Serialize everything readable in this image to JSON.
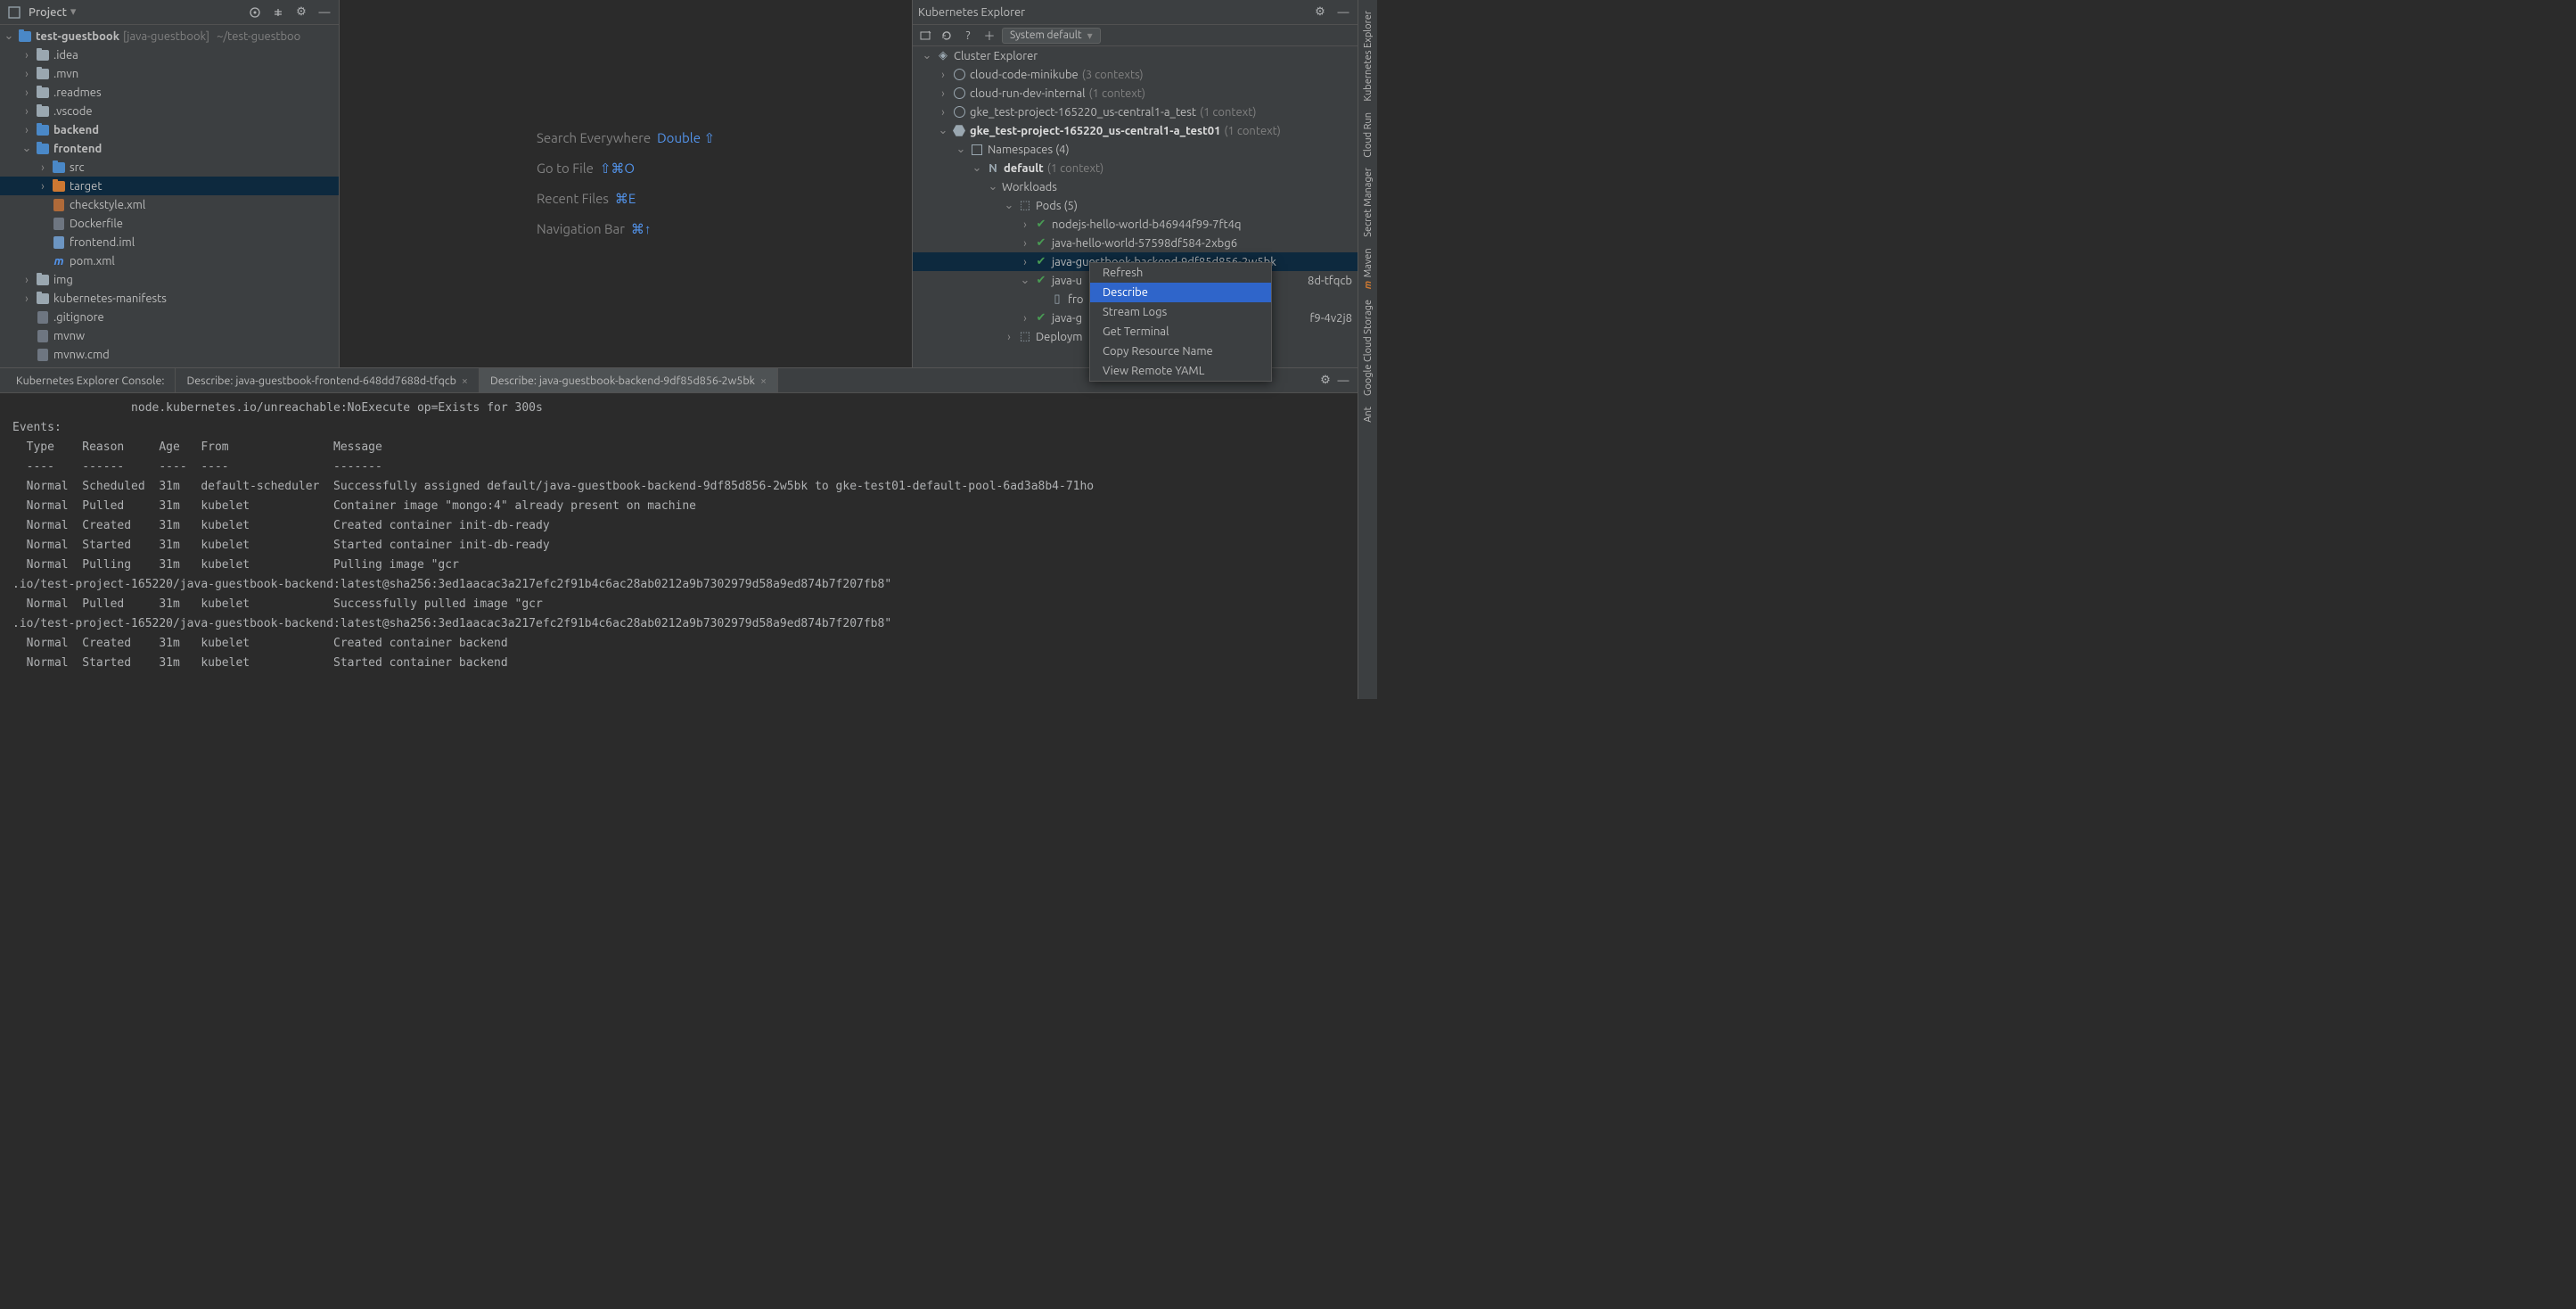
{
  "project_panel": {
    "title": "Project",
    "root": {
      "name": "test-guestbook",
      "bracket": "[java-guestbook]",
      "path": "~/test-guestboo"
    },
    "items": [
      {
        "indent": 1,
        "name": ".idea",
        "folder": "gray",
        "chev": "›"
      },
      {
        "indent": 1,
        "name": ".mvn",
        "folder": "gray",
        "chev": "›"
      },
      {
        "indent": 1,
        "name": ".readmes",
        "folder": "gray",
        "chev": "›"
      },
      {
        "indent": 1,
        "name": ".vscode",
        "folder": "gray",
        "chev": "›"
      },
      {
        "indent": 1,
        "name": "backend",
        "folder": "blue",
        "chev": "›",
        "bold": true
      },
      {
        "indent": 1,
        "name": "frontend",
        "folder": "blue",
        "chev": "⌄",
        "bold": true
      },
      {
        "indent": 2,
        "name": "src",
        "folder": "blue",
        "chev": "›"
      },
      {
        "indent": 2,
        "name": "target",
        "folder": "or",
        "chev": "›",
        "sel": true
      },
      {
        "indent": 2,
        "name": "checkstyle.xml",
        "file": "xml"
      },
      {
        "indent": 2,
        "name": "Dockerfile",
        "file": "plain"
      },
      {
        "indent": 2,
        "name": "frontend.iml",
        "file": "iml"
      },
      {
        "indent": 2,
        "name": "pom.xml",
        "file": "m"
      },
      {
        "indent": 1,
        "name": "img",
        "folder": "gray",
        "chev": "›"
      },
      {
        "indent": 1,
        "name": "kubernetes-manifests",
        "folder": "gray",
        "chev": "›"
      },
      {
        "indent": 1,
        "name": ".gitignore",
        "file": "plain"
      },
      {
        "indent": 1,
        "name": "mvnw",
        "file": "plain"
      },
      {
        "indent": 1,
        "name": "mvnw.cmd",
        "file": "plain"
      }
    ]
  },
  "hints": {
    "search": {
      "label": "Search Everywhere",
      "key": "Double ⇧"
    },
    "goto": {
      "label": "Go to File",
      "key": "⇧⌘O"
    },
    "recent": {
      "label": "Recent Files",
      "key": "⌘E"
    },
    "nav": {
      "label": "Navigation Bar",
      "key": "⌘↑"
    }
  },
  "kube": {
    "title": "Kubernetes Explorer",
    "combo": "System default",
    "root": "Cluster Explorer",
    "clusters": [
      {
        "name": "cloud-code-minikube",
        "ctx": "(3 contexts)",
        "ico": "circ",
        "chev": "›"
      },
      {
        "name": "cloud-run-dev-internal",
        "ctx": "(1 context)",
        "ico": "circ",
        "chev": "›"
      },
      {
        "name": "gke_test-project-165220_us-central1-a_test",
        "ctx": "(1 context)",
        "ico": "circ",
        "chev": "›"
      },
      {
        "name": "gke_test-project-165220_us-central1-a_test01",
        "ctx": "(1 context)",
        "ico": "hex",
        "chev": "⌄",
        "bold": true
      }
    ],
    "ns_label": "Namespaces (4)",
    "default_ns": {
      "name": "default",
      "ctx": "(1 context)"
    },
    "workloads": "Workloads",
    "pods_label": "Pods (5)",
    "pods": [
      {
        "name": "nodejs-hello-world-b46944f99-7ft4q",
        "chev": "›"
      },
      {
        "name": "java-hello-world-57598df584-2xbg6",
        "chev": "›"
      },
      {
        "name": "java-guestbook-backend-9df85d856-2w5bk",
        "chev": "›",
        "sel": true
      },
      {
        "name": "java-guestbook-frontend-648dd7688d-tfqcb",
        "vis": "java-u",
        "tail": "8d-tfqcb",
        "chev": "⌄"
      },
      {
        "name_child": "frontend",
        "vis": "fro"
      },
      {
        "name": "java-guestbook-mongodb-6cf944c5f9-4v2j8",
        "vis": "java-g",
        "tail": "f9-4v2j8",
        "chev": "›"
      }
    ],
    "deploy_label": "Deploym",
    "context_menu": [
      "Refresh",
      "Describe",
      "Stream Logs",
      "Get Terminal",
      "Copy Resource Name",
      "View Remote YAML"
    ],
    "ctx_selected": 1
  },
  "right_tabs": [
    "Kubernetes Explorer",
    "Cloud Run",
    "Secret Manager",
    "Maven",
    "Google Cloud Storage",
    "Ant"
  ],
  "console": {
    "left_label": "Kubernetes Explorer Console:",
    "tabs": [
      {
        "label": "Describe: java-guestbook-frontend-648dd7688d-tfqcb"
      },
      {
        "label": "Describe: java-guestbook-backend-9df85d856-2w5bk",
        "active": true
      }
    ],
    "lines": [
      "                 node.kubernetes.io/unreachable:NoExecute op=Exists for 300s",
      "Events:",
      "  Type    Reason     Age   From               Message",
      "  ----    ------     ----  ----               -------",
      "  Normal  Scheduled  31m   default-scheduler  Successfully assigned default/java-guestbook-backend-9df85d856-2w5bk to gke-test01-default-pool-6ad3a8b4-71ho",
      "  Normal  Pulled     31m   kubelet            Container image \"mongo:4\" already present on machine",
      "  Normal  Created    31m   kubelet            Created container init-db-ready",
      "  Normal  Started    31m   kubelet            Started container init-db-ready",
      "  Normal  Pulling    31m   kubelet            Pulling image \"gcr",
      ".io/test-project-165220/java-guestbook-backend:latest@sha256:3ed1aacac3a217efc2f91b4c6ac28ab0212a9b7302979d58a9ed874b7f207fb8\"",
      "  Normal  Pulled     31m   kubelet            Successfully pulled image \"gcr",
      ".io/test-project-165220/java-guestbook-backend:latest@sha256:3ed1aacac3a217efc2f91b4c6ac28ab0212a9b7302979d58a9ed874b7f207fb8\"",
      "  Normal  Created    31m   kubelet            Created container backend",
      "  Normal  Started    31m   kubelet            Started container backend"
    ]
  }
}
